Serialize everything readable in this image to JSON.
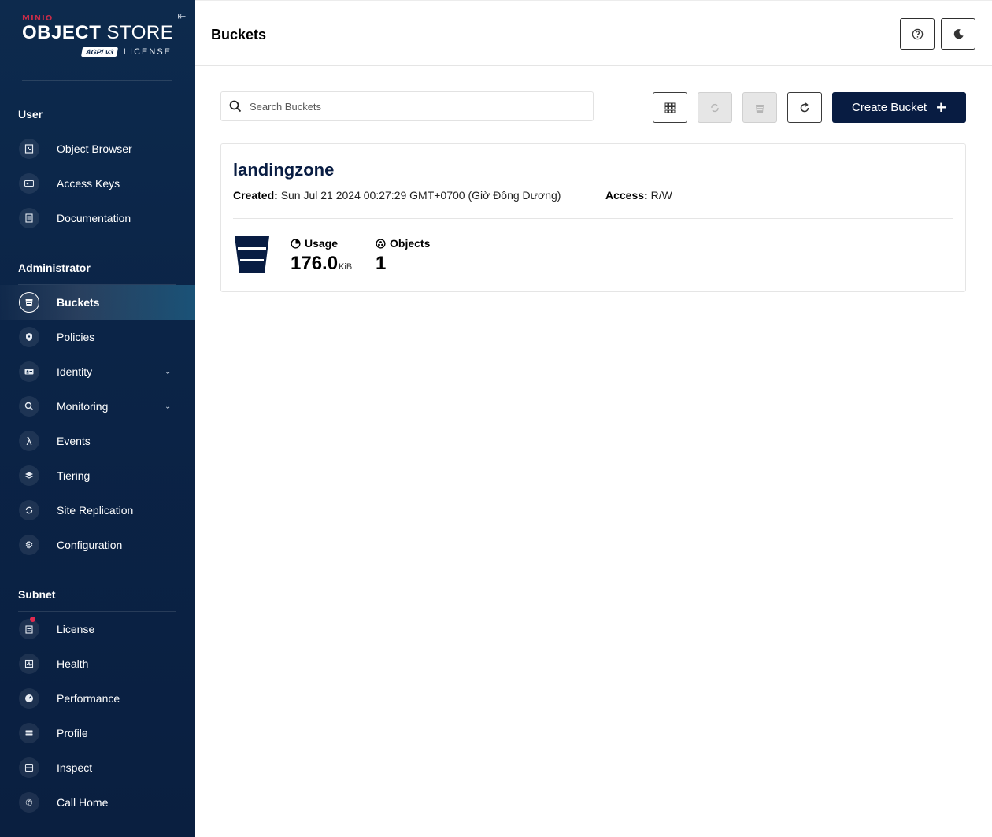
{
  "brand": {
    "minio": "MINIO",
    "title_bold": "OBJECT",
    "title_thin": "STORE",
    "agpl": "AGPLv3",
    "license": "LICENSE"
  },
  "sidebar": {
    "sections": {
      "user": "User",
      "administrator": "Administrator",
      "subnet": "Subnet"
    },
    "user_items": [
      {
        "label": "Object Browser",
        "icon": "object-browser-icon"
      },
      {
        "label": "Access Keys",
        "icon": "access-keys-icon"
      },
      {
        "label": "Documentation",
        "icon": "documentation-icon"
      }
    ],
    "admin_items": [
      {
        "label": "Buckets",
        "icon": "bucket-icon",
        "active": true
      },
      {
        "label": "Policies",
        "icon": "policies-icon"
      },
      {
        "label": "Identity",
        "icon": "identity-icon",
        "expandable": true
      },
      {
        "label": "Monitoring",
        "icon": "monitoring-icon",
        "expandable": true
      },
      {
        "label": "Events",
        "icon": "lambda-icon"
      },
      {
        "label": "Tiering",
        "icon": "tiering-icon"
      },
      {
        "label": "Site Replication",
        "icon": "site-replication-icon"
      },
      {
        "label": "Configuration",
        "icon": "gear-icon"
      }
    ],
    "subnet_items": [
      {
        "label": "License",
        "icon": "license-icon",
        "badge": true
      },
      {
        "label": "Health",
        "icon": "health-icon"
      },
      {
        "label": "Performance",
        "icon": "performance-icon"
      },
      {
        "label": "Profile",
        "icon": "profile-icon"
      },
      {
        "label": "Inspect",
        "icon": "inspect-icon"
      },
      {
        "label": "Call Home",
        "icon": "call-home-icon"
      }
    ]
  },
  "header": {
    "title": "Buckets"
  },
  "toolbar": {
    "search_placeholder": "Search Buckets",
    "create_label": "Create Bucket"
  },
  "bucket": {
    "name": "landingzone",
    "created_label": "Created:",
    "created_value": "Sun Jul 21 2024 00:27:29 GMT+0700 (Giờ Đông Dương)",
    "access_label": "Access:",
    "access_value": "R/W",
    "usage_label": "Usage",
    "usage_value": "176.0",
    "usage_unit": "KiB",
    "objects_label": "Objects",
    "objects_value": "1"
  },
  "colors": {
    "sidebar_bg": "#0b2447",
    "primary": "#081c42",
    "badge": "#e02a4f"
  }
}
